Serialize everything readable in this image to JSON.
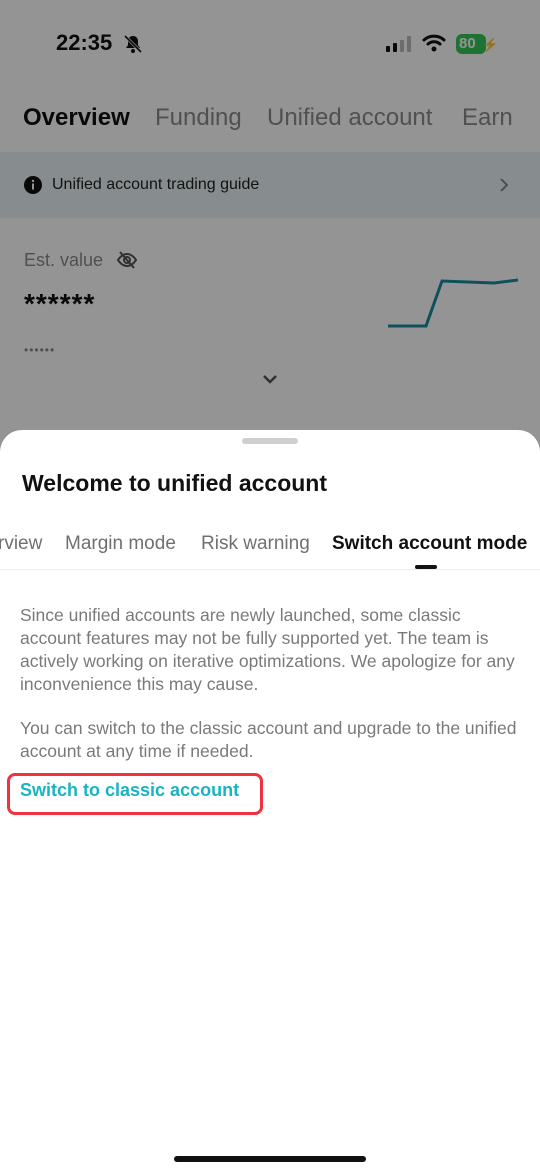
{
  "status_bar": {
    "time": "22:35",
    "battery": "80",
    "icons": [
      "bell-slash-icon",
      "signal-icon",
      "wifi-icon",
      "battery-charging-icon"
    ]
  },
  "background": {
    "tabs": [
      "Overview",
      "Funding",
      "Unified account",
      "Earn"
    ],
    "active_tab": "Overview",
    "guide_text": "Unified account trading guide",
    "est_label": "Est. value",
    "est_value": "******",
    "est_sub": "••••••",
    "accent_color": "#1a8ba0"
  },
  "sheet": {
    "title": "Welcome to unified account",
    "tabs": [
      "rview",
      "Margin mode",
      "Risk warning",
      "Switch account mode"
    ],
    "active_tab": "Switch account mode",
    "paragraph1": "Since unified accounts are newly launched, some classic account features may not be fully supported yet. The team is actively working on iterative optimizations. We apologize for any inconvenience this may cause.",
    "paragraph2": "You can switch to the classic account and upgrade to the unified account at any time if needed.",
    "switch_link": "Switch to classic account",
    "link_color": "#18b4c4",
    "highlight_color": "#f0313f"
  }
}
